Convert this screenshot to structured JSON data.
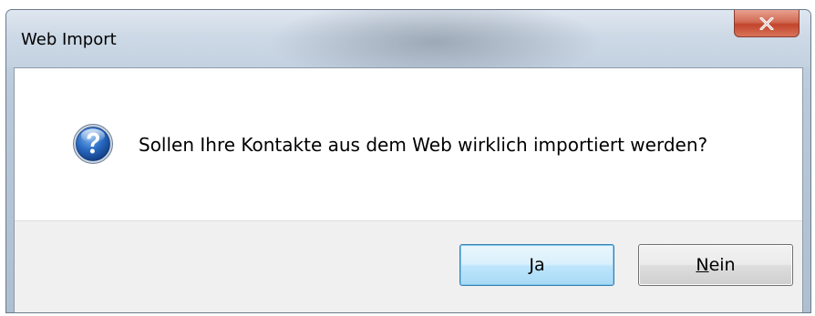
{
  "window": {
    "title": "Web Import"
  },
  "dialog": {
    "icon": "question-icon",
    "message": "Sollen Ihre Kontakte aus dem Web wirklich importiert werden?"
  },
  "buttons": {
    "yes_label": "Ja",
    "no_mnemonic": "N",
    "no_rest": "ein"
  },
  "icons": {
    "close": "close-icon",
    "question": "question-icon"
  },
  "colors": {
    "close_button": "#c2452c",
    "default_button_border": "#3c7fb1",
    "question_icon": "#1f5fb0"
  }
}
